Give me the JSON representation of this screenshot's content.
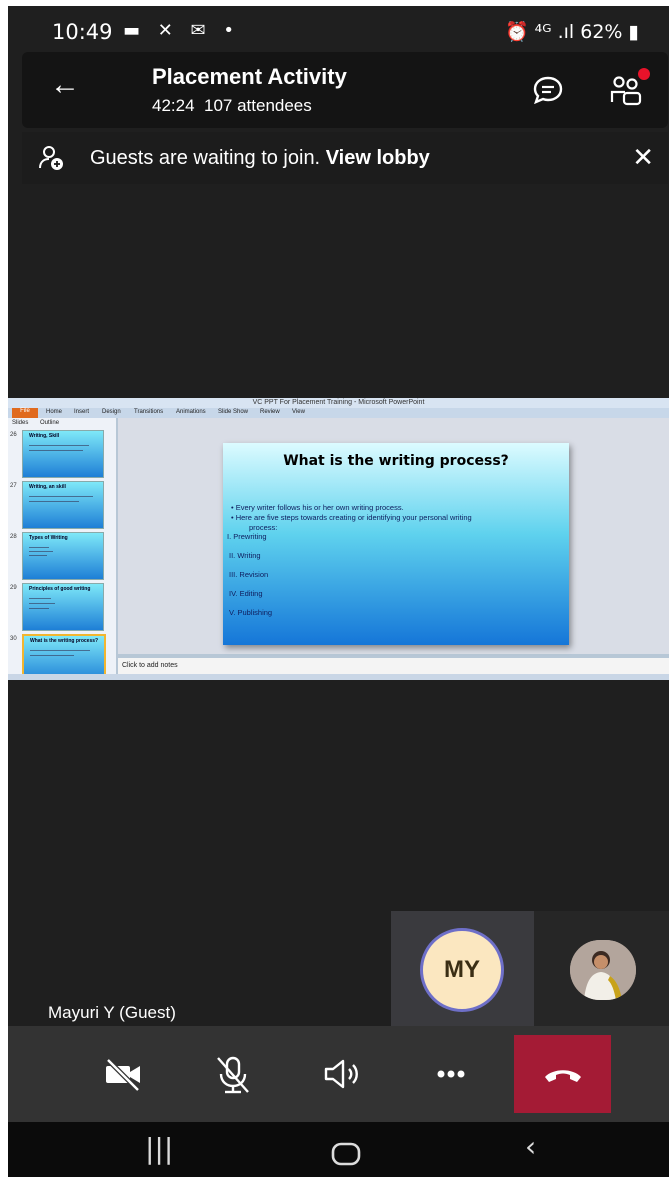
{
  "status_bar": {
    "time": "10:49",
    "left_icons": "▬ ✕ ✉ •",
    "right_icons": "⏰ ⁴ᴳ .ıl",
    "battery": "62%"
  },
  "meeting": {
    "title": "Placement Activity",
    "duration": "42:24",
    "attendees": "107 attendees"
  },
  "banner": {
    "text": "Guests are waiting to join.",
    "link": "View lobby"
  },
  "shared_screen": {
    "window_title": "VC PPT For Placement Training - Microsoft PowerPoint",
    "ribbon_tabs": [
      "File",
      "Home",
      "Insert",
      "Design",
      "Transitions",
      "Animations",
      "Slide Show",
      "Review",
      "View"
    ],
    "panel_tabs": [
      "Slides",
      "Outline"
    ],
    "thumbnails": [
      {
        "num": "26",
        "title": "Writing, Skill"
      },
      {
        "num": "27",
        "title": "Writing, an skill"
      },
      {
        "num": "28",
        "title": "Types of Writing"
      },
      {
        "num": "29",
        "title": "Principles of good writing"
      },
      {
        "num": "30",
        "title": "What is the writing process?"
      }
    ],
    "slide": {
      "title": "What is the writing process?",
      "bullet1": "•   Every writer follows his or her own writing process.",
      "bullet2": "•   Here are five steps towards creating or identifying your personal writing",
      "bullet2b": "process:",
      "steps": [
        "I. Prewriting",
        "II. Writing",
        "III. Revision",
        "IV. Editing",
        "V. Publishing"
      ]
    },
    "notes_placeholder": "Click to add notes"
  },
  "participants": {
    "active_speaker": "Mayuri Y (Guest)",
    "tile_initials": "MY"
  },
  "icons": {
    "back": "arrow-left-icon",
    "chat": "chat-icon",
    "people": "people-icon",
    "close": "close-icon",
    "guest": "guest-icon"
  },
  "colors": {
    "hangup": "#a41b35",
    "notification_dot": "#e8122a",
    "avatar_ring": "#6e6fc8"
  }
}
